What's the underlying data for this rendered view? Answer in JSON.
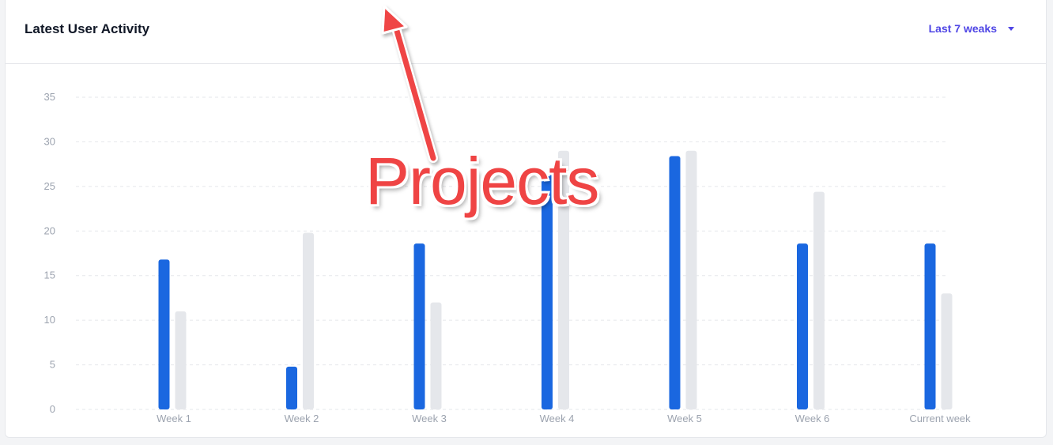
{
  "header": {
    "title": "Latest User Activity",
    "range_label": "Last 7 weaks"
  },
  "annotation": {
    "text": "Projects",
    "color": "#ef4444"
  },
  "chart_data": {
    "type": "bar",
    "categories": [
      "Week 1",
      "Week 2",
      "Week 3",
      "Week 4",
      "Week 5",
      "Week 6",
      "Current week"
    ],
    "series": [
      {
        "values": [
          16.8,
          4.8,
          18.6,
          26.6,
          28.4,
          18.6,
          18.6
        ],
        "color": "#1a67e0"
      },
      {
        "values": [
          11,
          19.8,
          12,
          29,
          29,
          24.4,
          13
        ],
        "color": "#e5e7eb"
      }
    ],
    "ylim": [
      0,
      35
    ],
    "yticks": [
      "35",
      "30",
      "25",
      "20",
      "15",
      "10",
      "5",
      "0"
    ],
    "grid": true
  }
}
